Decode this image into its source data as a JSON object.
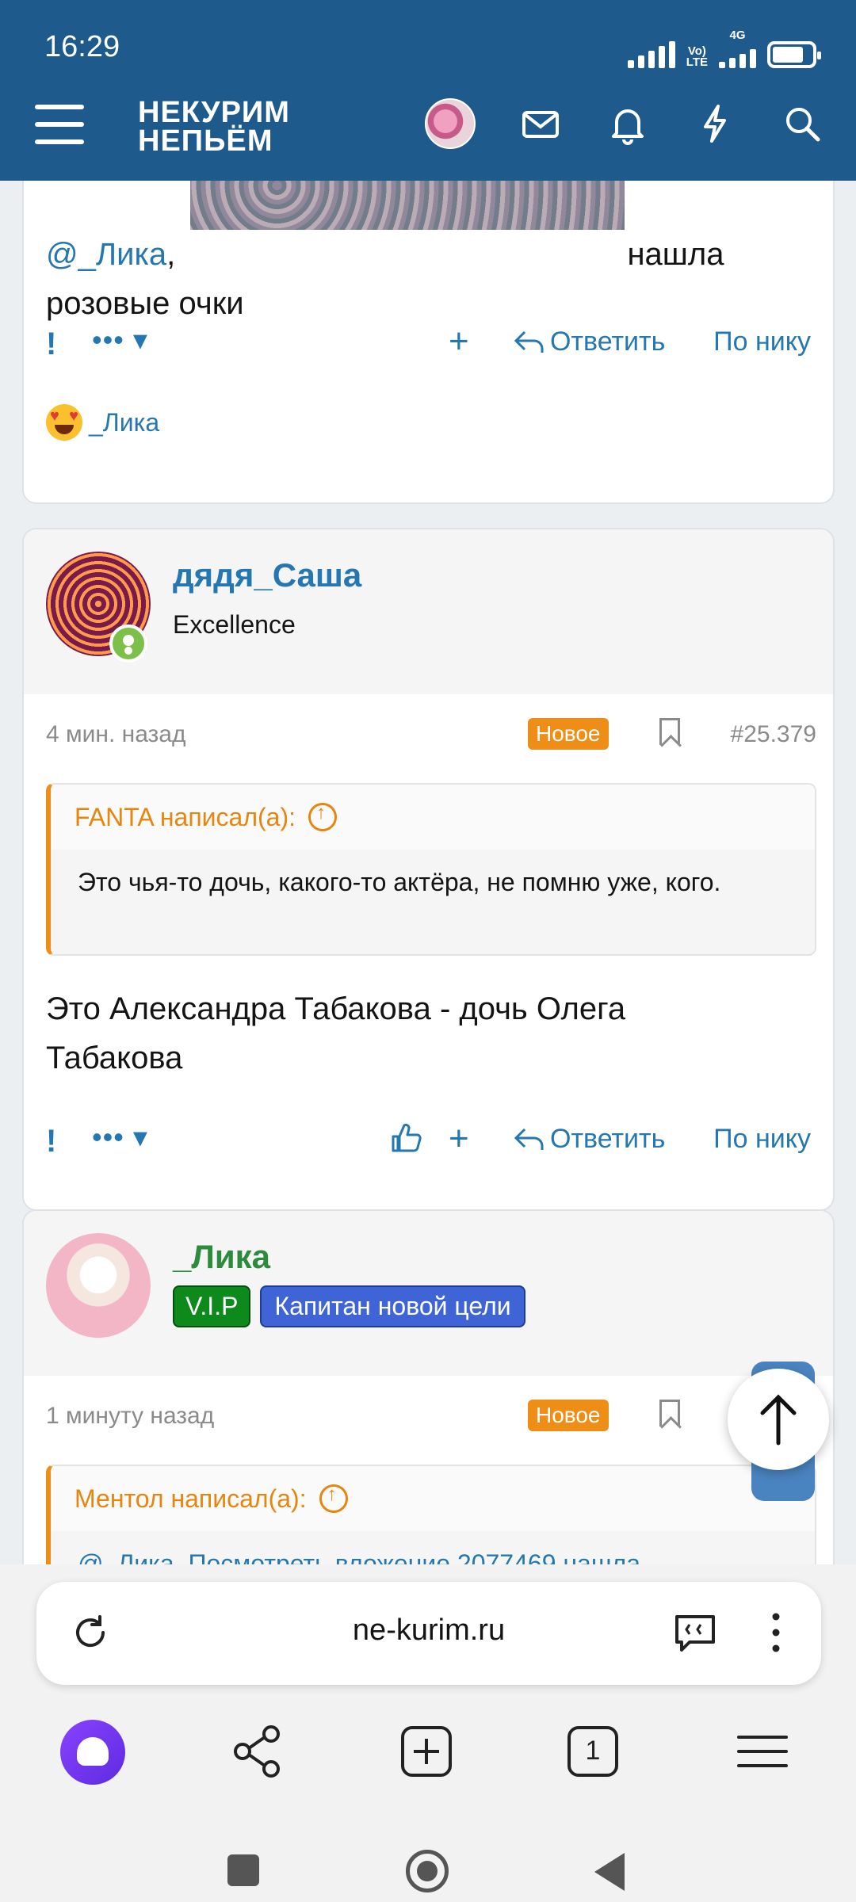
{
  "status_bar": {
    "time": "16:29",
    "volte": "Vo\nLTE",
    "network": "4G"
  },
  "header": {
    "logo_line1": "НЕКУРИМ",
    "logo_line2": "НЕПЬЁМ",
    "icons": [
      "menu-icon",
      "avatar",
      "mail-icon",
      "bell-icon",
      "lightning-icon",
      "search-icon"
    ]
  },
  "post1": {
    "mention": "@_Лика",
    "comma": ",",
    "text_after": " нашла",
    "text_line2": "розовые очки",
    "actions": {
      "report": "!",
      "more": "•••",
      "plus": "+",
      "reply": "Ответить",
      "by_nick": "По нику"
    },
    "reaction_user": "_Лика"
  },
  "post2": {
    "username": "дядя_Саша",
    "user_title": "Excellence",
    "time": "4 мин. назад",
    "new_badge": "Новое",
    "post_number": "#25.379",
    "quote_author": "FANTA написал(а):",
    "quote_text": "Это чья-то дочь, какого-то актёра, не помню уже, кого.",
    "text": "Это Александра Табакова - дочь Олега Табакова",
    "actions": {
      "report": "!",
      "more": "•••",
      "plus": "+",
      "reply": "Ответить",
      "by_nick": "По нику"
    }
  },
  "post3": {
    "username": "_Лика",
    "badge1": "V.I.P",
    "badge2": "Капитан новой цели",
    "time": "1 минуту назад",
    "new_badge": "Новое",
    "post_number_partial": "#",
    "quote_author": "Ментол написал(а):",
    "quote_text_partial": "@_Лика, Посмотреть вложение 2077469 нашла"
  },
  "browser": {
    "url": "ne-kurim.ru",
    "bottom_icons": [
      "alice-icon",
      "share-icon",
      "new-tab-icon",
      "tabs-icon",
      "menu-icon"
    ],
    "tab_count": "1"
  },
  "colors": {
    "header": "#1f5a8c",
    "link": "#2577b1",
    "accent": "#ef8e16",
    "vip": "#0e8a1d",
    "captain": "#3e64d6"
  }
}
